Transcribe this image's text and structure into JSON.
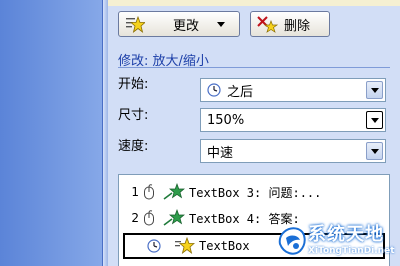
{
  "toolbar": {
    "change_label": "更改",
    "delete_label": "删除"
  },
  "section": {
    "title": "修改: 放大/缩小"
  },
  "fields": {
    "start_label": "开始:",
    "start_value": "之后",
    "size_label": "尺寸:",
    "size_value": "150%",
    "speed_label": "速度:",
    "speed_value": "中速"
  },
  "animation_list": [
    {
      "index": "1",
      "text": "TextBox 3: 问题:..."
    },
    {
      "index": "2",
      "text": "TextBox 4: 答案:"
    },
    {
      "index": "",
      "text": "TextBox"
    }
  ],
  "watermark": {
    "title": "系统天地",
    "url": "XiTongTianDi.net"
  },
  "icons": {
    "change": "star-effect-icon",
    "delete": "delete-effect-icon",
    "start": "clock-icon",
    "mouse": "mouse-click-icon",
    "effect": "green-star-icon"
  }
}
